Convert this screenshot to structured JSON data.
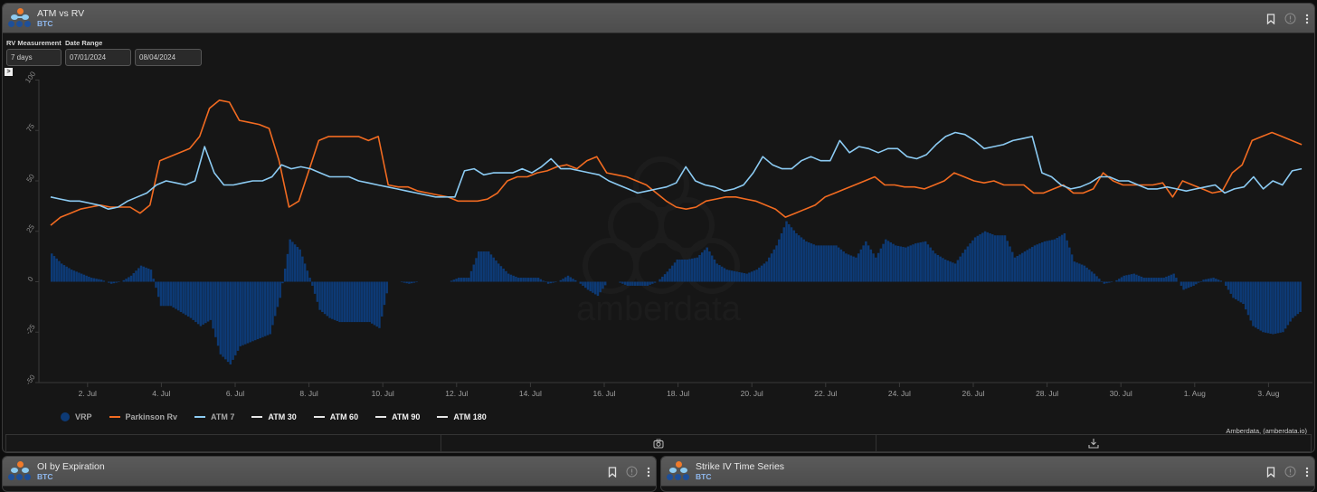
{
  "main_panel": {
    "title": "ATM vs RV",
    "subtitle": "BTC",
    "controls": {
      "rv_measurement_label": "RV Measurement",
      "rv_measurement_value": "7 days",
      "date_range_label": "Date Range",
      "date_start": "07/01/2024",
      "date_end": "08/04/2024"
    },
    "toggle_label": ">",
    "credit": "Amberdata, (amberdata.io)",
    "watermark": "amberdata",
    "icons": [
      "bookmark-icon",
      "info-icon",
      "more-vertical-icon"
    ],
    "footer_icons": [
      "camera-icon",
      "download-icon"
    ]
  },
  "bottom_panels": [
    {
      "title": "OI by Expiration",
      "subtitle": "BTC"
    },
    {
      "title": "Strike IV Time Series",
      "subtitle": "BTC"
    }
  ],
  "colors": {
    "vrp": "#0d3a75",
    "parkinson": "#f26b21",
    "atm7": "#8ccbf3",
    "atm_other": "#e6e6e6",
    "logo_orange": "#f07a2a",
    "logo_light": "#8ecbf0",
    "logo_dark": "#1e4f99",
    "subtitle": "#8fb8ee"
  },
  "chart_data": {
    "type": "line",
    "title": "ATM vs RV",
    "xlabel": "",
    "ylabel": "",
    "ylim": [
      -50,
      100
    ],
    "yticks": [
      "100",
      "75",
      "50",
      "25",
      "0",
      "-25",
      "-50"
    ],
    "xlim_days": [
      0,
      34.2
    ],
    "x_start_date": "2024-07-01",
    "xticks": [
      {
        "day": 1,
        "label": "2. Jul"
      },
      {
        "day": 3,
        "label": "4. Jul"
      },
      {
        "day": 5,
        "label": "6. Jul"
      },
      {
        "day": 7,
        "label": "8. Jul"
      },
      {
        "day": 9,
        "label": "10. Jul"
      },
      {
        "day": 11,
        "label": "12. Jul"
      },
      {
        "day": 13,
        "label": "14. Jul"
      },
      {
        "day": 15,
        "label": "16. Jul"
      },
      {
        "day": 17,
        "label": "18. Jul"
      },
      {
        "day": 19,
        "label": "20. Jul"
      },
      {
        "day": 21,
        "label": "22. Jul"
      },
      {
        "day": 23,
        "label": "24. Jul"
      },
      {
        "day": 25,
        "label": "26. Jul"
      },
      {
        "day": 27,
        "label": "28. Jul"
      },
      {
        "day": 29,
        "label": "30. Jul"
      },
      {
        "day": 31,
        "label": "1. Aug"
      },
      {
        "day": 33,
        "label": "3. Aug"
      }
    ],
    "x_step_days": 0.5,
    "legend_position": "bottom-left",
    "grid": false,
    "series": [
      {
        "name": "Parkinson Rv",
        "type": "line",
        "values": [
          28,
          32,
          34,
          36,
          37,
          38,
          37,
          37,
          37,
          34,
          38,
          60,
          62,
          64,
          66,
          72,
          86,
          90,
          89,
          80,
          79,
          78,
          76,
          60,
          37,
          40,
          55,
          70,
          72,
          72,
          72,
          72,
          70,
          72,
          48,
          47,
          47,
          45,
          44,
          43,
          42,
          40,
          40,
          40,
          41,
          44,
          50,
          52,
          52,
          54,
          55,
          57,
          58,
          56,
          60,
          62,
          54,
          53,
          52,
          50,
          48,
          44,
          40,
          37,
          36,
          37,
          40,
          41,
          42,
          42,
          41,
          40,
          38,
          36,
          32,
          34,
          36,
          38,
          42,
          44,
          46,
          48,
          50,
          52,
          48,
          48,
          47,
          47,
          46,
          48,
          50,
          54,
          52,
          50,
          49,
          50,
          48,
          48,
          48,
          44,
          44,
          46,
          48,
          44,
          44,
          46,
          54,
          50,
          48,
          48,
          48,
          48,
          49,
          42,
          50,
          48,
          46,
          44,
          45,
          54,
          58,
          70,
          72,
          74,
          72,
          70,
          68
        ]
      },
      {
        "name": "ATM 7",
        "type": "line",
        "values": [
          42,
          41,
          40,
          40,
          39,
          38,
          36,
          37,
          40,
          42,
          44,
          48,
          50,
          49,
          48,
          50,
          67,
          54,
          48,
          48,
          49,
          50,
          50,
          52,
          58,
          56,
          57,
          56,
          54,
          52,
          52,
          52,
          50,
          49,
          48,
          47,
          46,
          45,
          44,
          43,
          42,
          42,
          42,
          55,
          56,
          53,
          54,
          54,
          54,
          56,
          54,
          57,
          61,
          56,
          56,
          55,
          54,
          53,
          50,
          48,
          46,
          44,
          45,
          46,
          47,
          49,
          57,
          50,
          48,
          47,
          45,
          46,
          48,
          54,
          62,
          58,
          56,
          56,
          60,
          62,
          60,
          60,
          70,
          64,
          67,
          66,
          64,
          66,
          66,
          62,
          61,
          63,
          68,
          72,
          74,
          73,
          70,
          66,
          67,
          68,
          70,
          71,
          72,
          54,
          52,
          48,
          46,
          47,
          49,
          52,
          52,
          50,
          50,
          48,
          46,
          46,
          47,
          46,
          45,
          46,
          47,
          48,
          44,
          46,
          47,
          52,
          46,
          50,
          48,
          55,
          56
        ]
      },
      {
        "name": "VRP",
        "type": "column",
        "values": [
          14,
          9,
          6,
          4,
          2,
          1,
          -1,
          0,
          3,
          8,
          6,
          -12,
          -12,
          -15,
          -18,
          -22,
          -19,
          -36,
          -41,
          -32,
          -30,
          -28,
          -26,
          -8,
          21,
          16,
          2,
          -14,
          -18,
          -20,
          -20,
          -20,
          -20,
          -23,
          0,
          0,
          -1,
          0,
          0,
          0,
          0,
          2,
          2,
          15,
          15,
          9,
          4,
          2,
          2,
          2,
          -1,
          0,
          3,
          0,
          -4,
          -7,
          0,
          0,
          -2,
          -2,
          -2,
          0,
          5,
          11,
          11,
          12,
          17,
          9,
          6,
          5,
          4,
          6,
          10,
          18,
          30,
          24,
          20,
          18,
          18,
          18,
          14,
          12,
          20,
          12,
          21,
          18,
          17,
          19,
          20,
          14,
          11,
          9,
          16,
          22,
          25,
          23,
          23,
          12,
          15,
          18,
          20,
          21,
          24,
          10,
          8,
          4,
          -1,
          0,
          3,
          4,
          2,
          2,
          2,
          4,
          -4,
          -2,
          1,
          2,
          0,
          -8,
          -11,
          -22,
          -25,
          -26,
          -25,
          -18,
          -14
        ]
      },
      {
        "name": "ATM 30",
        "type": "line",
        "values": []
      },
      {
        "name": "ATM 60",
        "type": "line",
        "values": []
      },
      {
        "name": "ATM 90",
        "type": "line",
        "values": []
      },
      {
        "name": "ATM 180",
        "type": "line",
        "values": []
      }
    ],
    "legend": [
      "VRP",
      "Parkinson Rv",
      "ATM 7",
      "ATM 30",
      "ATM 60",
      "ATM 90",
      "ATM 180"
    ]
  }
}
